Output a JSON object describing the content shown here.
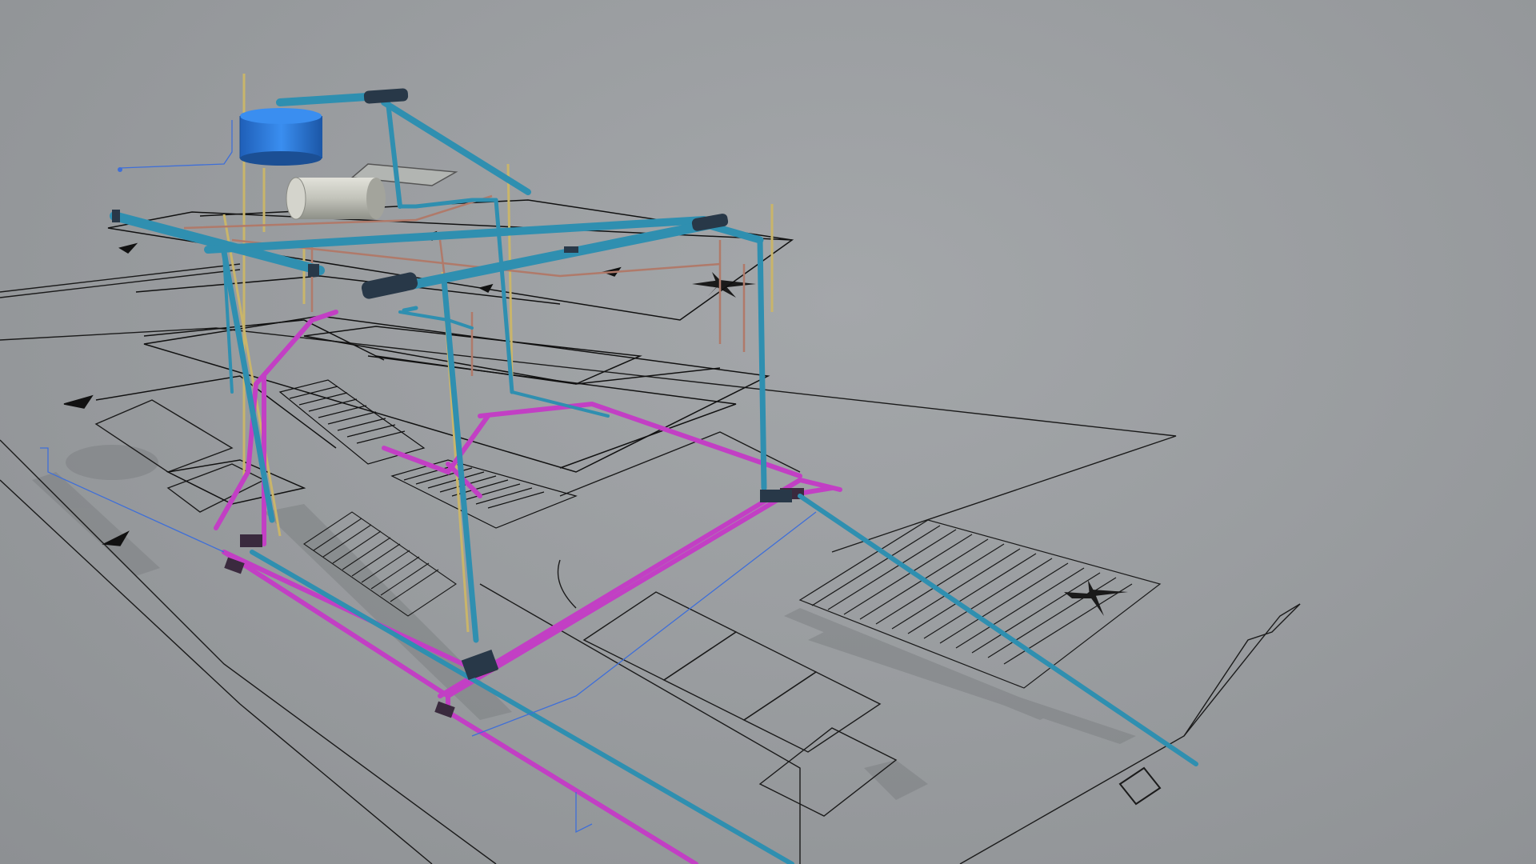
{
  "viewer": {
    "mode": "3d-model-viewer",
    "background_color": "#9b9ea1",
    "colors": {
      "cold_water_pipe": "#2f8fb0",
      "sewage_pipe": "#c23fc4",
      "hot_water_pipe": "#c9b56a",
      "gas_pipe": "#b07a6a",
      "water_tank": "#2a78d6",
      "water_heater": "#c8c8c0",
      "floor_plan_lines": "#111111",
      "drawing_blue_line": "#3f6fd8"
    },
    "objects": [
      {
        "name": "water-tank",
        "color_key": "water_tank"
      },
      {
        "name": "water-heater",
        "color_key": "water_heater"
      },
      {
        "name": "cold-water-pipes",
        "color_key": "cold_water_pipe"
      },
      {
        "name": "sewage-pipes",
        "color_key": "sewage_pipe"
      },
      {
        "name": "hot-water-pipes",
        "color_key": "hot_water_pipe"
      },
      {
        "name": "gas-pipes",
        "color_key": "gas_pipe"
      },
      {
        "name": "ground-floor-plan",
        "color_key": "floor_plan_lines"
      },
      {
        "name": "upper-floor-plan",
        "color_key": "floor_plan_lines"
      },
      {
        "name": "roof-plan",
        "color_key": "floor_plan_lines"
      }
    ]
  }
}
